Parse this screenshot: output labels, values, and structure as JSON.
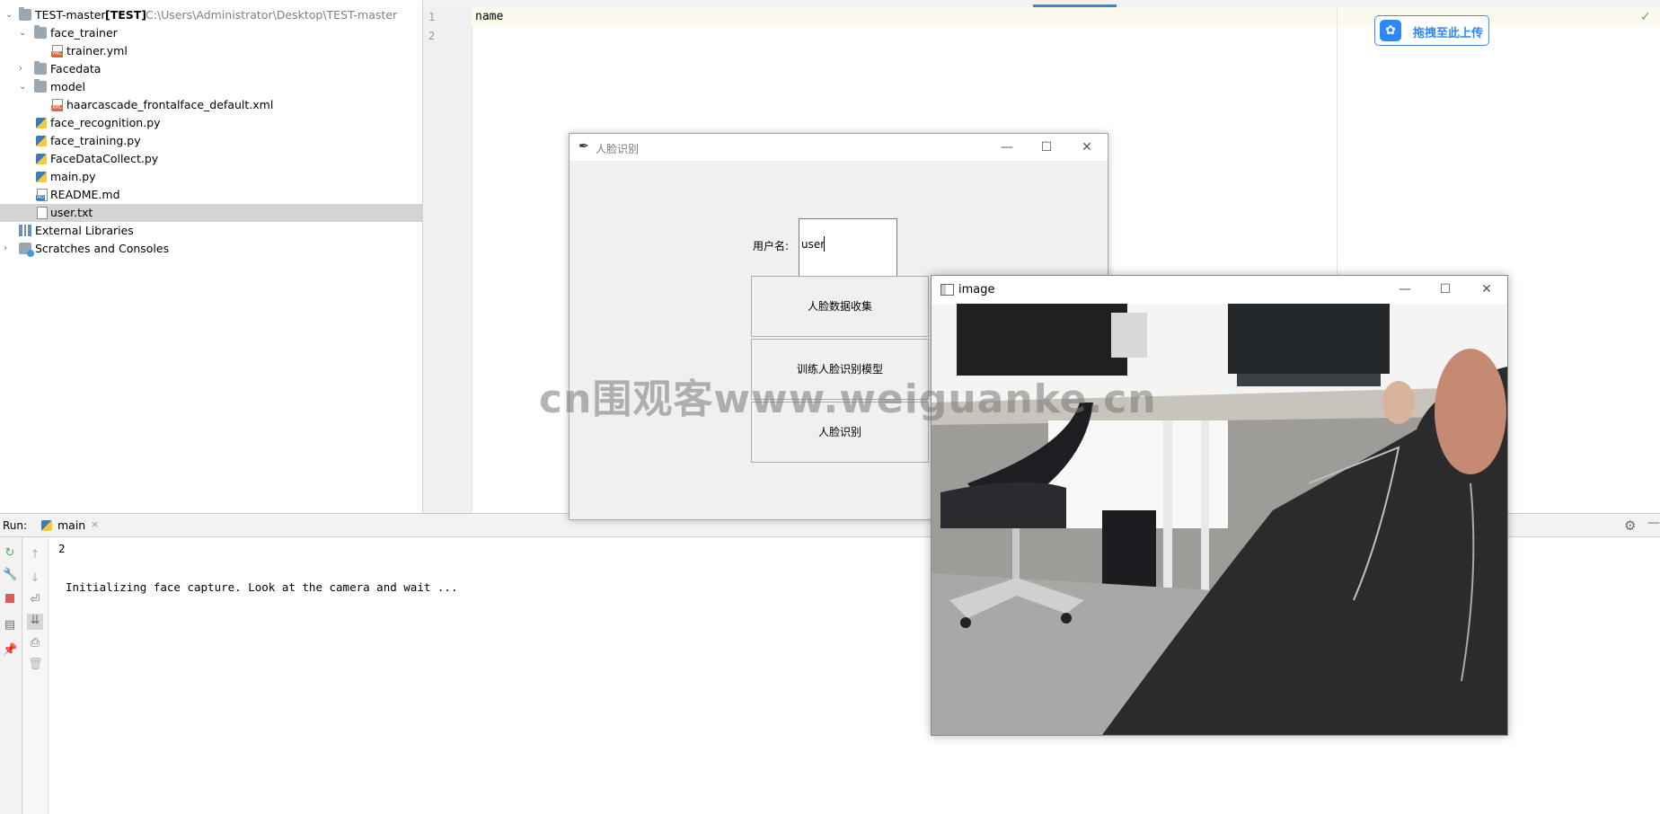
{
  "project_tree": {
    "root_name": "TEST-master",
    "root_tag": "[TEST]",
    "root_path": "C:\\Users\\Administrator\\Desktop\\TEST-master",
    "items": [
      {
        "label": "face_trainer"
      },
      {
        "label": "trainer.yml"
      },
      {
        "label": "Facedata"
      },
      {
        "label": "model"
      },
      {
        "label": "haarcascade_frontalface_default.xml"
      },
      {
        "label": "face_recognition.py"
      },
      {
        "label": "face_training.py"
      },
      {
        "label": "FaceDataCollect.py"
      },
      {
        "label": "main.py"
      },
      {
        "label": "README.md"
      },
      {
        "label": "user.txt"
      },
      {
        "label": "External Libraries"
      },
      {
        "label": "Scratches and Consoles"
      }
    ]
  },
  "editor": {
    "line_numbers": [
      "1",
      "2"
    ],
    "lines": [
      "name",
      ""
    ],
    "status_check": "✓"
  },
  "upload_button": {
    "label": "拖拽至此上传"
  },
  "run_panel": {
    "label": "Run:",
    "tab_label": "main",
    "tab_close": "×",
    "console_lines": [
      "2",
      "",
      "Initializing face capture. Look at the camera and wait ..."
    ]
  },
  "tk_window": {
    "title": "人脸识别",
    "username_label": "用户名:",
    "username_value": "user",
    "buttons": [
      "人脸数据收集",
      "训练人脸识别模型",
      "人脸识别"
    ]
  },
  "cv_window": {
    "title": "image"
  },
  "window_controls": {
    "minimize": "—",
    "maximize": "☐",
    "close": "✕"
  },
  "watermark": "cn围观客www.weiguanke.cn"
}
